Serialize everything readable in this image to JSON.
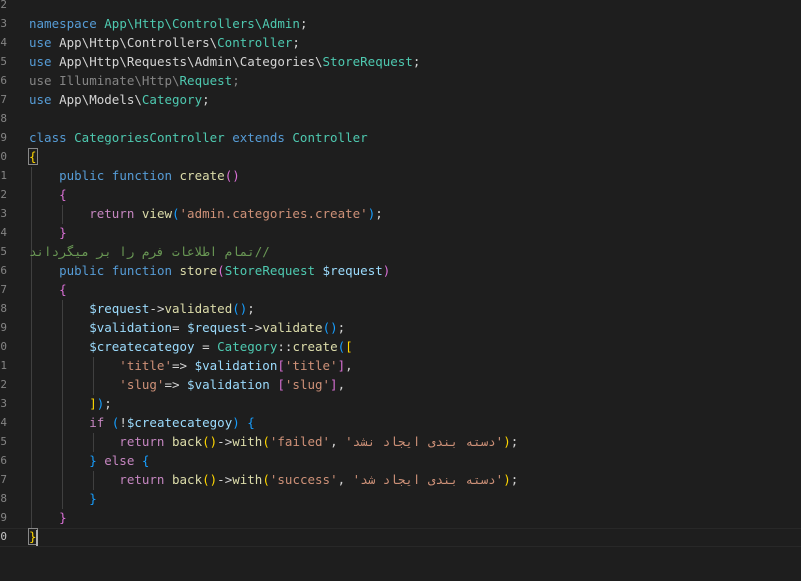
{
  "editor": {
    "line_numbers": [
      "2",
      "3",
      "4",
      "5",
      "6",
      "7",
      "8",
      "9",
      "0",
      "1",
      "2",
      "3",
      "4",
      "5",
      "6",
      "7",
      "8",
      "9",
      "0",
      "1",
      "2",
      "3",
      "4",
      "5",
      "6",
      "7",
      "8",
      "9",
      "0"
    ],
    "active_line_index": 28,
    "lines": [
      [],
      [
        {
          "t": "namespace ",
          "c": "kw"
        },
        {
          "t": "App\\Http\\Controllers\\Admin",
          "c": "cls"
        },
        {
          "t": ";",
          "c": "pln"
        }
      ],
      [
        {
          "t": "use ",
          "c": "kw"
        },
        {
          "t": "App\\Http\\Controllers\\",
          "c": "pln"
        },
        {
          "t": "Controller",
          "c": "cls"
        },
        {
          "t": ";",
          "c": "pln"
        }
      ],
      [
        {
          "t": "use ",
          "c": "kw"
        },
        {
          "t": "App\\Http\\Requests\\Admin\\Categories\\",
          "c": "pln"
        },
        {
          "t": "StoreRequest",
          "c": "cls"
        },
        {
          "t": ";",
          "c": "pln"
        }
      ],
      [
        {
          "t": "use Illuminate\\Http\\",
          "c": "dim"
        },
        {
          "t": "Request",
          "c": "cls"
        },
        {
          "t": ";",
          "c": "dim"
        }
      ],
      [
        {
          "t": "use ",
          "c": "kw"
        },
        {
          "t": "App\\Models\\",
          "c": "pln"
        },
        {
          "t": "Category",
          "c": "cls"
        },
        {
          "t": ";",
          "c": "pln"
        }
      ],
      [],
      [
        {
          "t": "class ",
          "c": "kw"
        },
        {
          "t": "CategoriesController",
          "c": "cls"
        },
        {
          "t": " extends ",
          "c": "kw"
        },
        {
          "t": "Controller",
          "c": "cls"
        }
      ],
      [
        {
          "t": "{",
          "c": "b1"
        }
      ],
      [
        {
          "t": "    public ",
          "c": "kw"
        },
        {
          "t": "function ",
          "c": "kw"
        },
        {
          "t": "create",
          "c": "fn"
        },
        {
          "t": "()",
          "c": "b2"
        }
      ],
      [
        {
          "t": "    {",
          "c": "b2"
        }
      ],
      [
        {
          "t": "        return ",
          "c": "ctl"
        },
        {
          "t": "view",
          "c": "fn"
        },
        {
          "t": "(",
          "c": "b3"
        },
        {
          "t": "'admin.categories.create'",
          "c": "str"
        },
        {
          "t": ")",
          "c": "b3"
        },
        {
          "t": ";",
          "c": "pln"
        }
      ],
      [
        {
          "t": "    }",
          "c": "b2"
        }
      ],
      [
        {
          "t": "    //تمام اطلاعات فرم را بر میگرداند",
          "c": "cmt"
        }
      ],
      [
        {
          "t": "    public ",
          "c": "kw"
        },
        {
          "t": "function ",
          "c": "kw"
        },
        {
          "t": "store",
          "c": "fn"
        },
        {
          "t": "(",
          "c": "b2"
        },
        {
          "t": "StoreRequest ",
          "c": "cls"
        },
        {
          "t": "$request",
          "c": "var"
        },
        {
          "t": ")",
          "c": "b2"
        }
      ],
      [
        {
          "t": "    {",
          "c": "b2"
        }
      ],
      [
        {
          "t": "        $request",
          "c": "var"
        },
        {
          "t": "->",
          "c": "pln"
        },
        {
          "t": "validated",
          "c": "fn"
        },
        {
          "t": "()",
          "c": "b3"
        },
        {
          "t": ";",
          "c": "pln"
        }
      ],
      [
        {
          "t": "        $validation",
          "c": "var"
        },
        {
          "t": "= ",
          "c": "pln"
        },
        {
          "t": "$request",
          "c": "var"
        },
        {
          "t": "->",
          "c": "pln"
        },
        {
          "t": "validate",
          "c": "fn"
        },
        {
          "t": "()",
          "c": "b3"
        },
        {
          "t": ";",
          "c": "pln"
        }
      ],
      [
        {
          "t": "        $createcategoy",
          "c": "var"
        },
        {
          "t": " = ",
          "c": "pln"
        },
        {
          "t": "Category",
          "c": "cls"
        },
        {
          "t": "::",
          "c": "pln"
        },
        {
          "t": "create",
          "c": "fn"
        },
        {
          "t": "(",
          "c": "b3"
        },
        {
          "t": "[",
          "c": "b1"
        }
      ],
      [
        {
          "t": "            'title'",
          "c": "str"
        },
        {
          "t": "=> ",
          "c": "pln"
        },
        {
          "t": "$validation",
          "c": "var"
        },
        {
          "t": "[",
          "c": "b2"
        },
        {
          "t": "'title'",
          "c": "str"
        },
        {
          "t": "]",
          "c": "b2"
        },
        {
          "t": ",",
          "c": "pln"
        }
      ],
      [
        {
          "t": "            'slug'",
          "c": "str"
        },
        {
          "t": "=> ",
          "c": "pln"
        },
        {
          "t": "$validation ",
          "c": "var"
        },
        {
          "t": "[",
          "c": "b2"
        },
        {
          "t": "'slug'",
          "c": "str"
        },
        {
          "t": "]",
          "c": "b2"
        },
        {
          "t": ",",
          "c": "pln"
        }
      ],
      [
        {
          "t": "        ]",
          "c": "b1"
        },
        {
          "t": ")",
          "c": "b3"
        },
        {
          "t": ";",
          "c": "pln"
        }
      ],
      [
        {
          "t": "        if ",
          "c": "ctl"
        },
        {
          "t": "(",
          "c": "b3"
        },
        {
          "t": "!",
          "c": "pln"
        },
        {
          "t": "$createcategoy",
          "c": "var"
        },
        {
          "t": ")",
          "c": "b3"
        },
        {
          "t": " ",
          "c": "pln"
        },
        {
          "t": "{",
          "c": "b3"
        }
      ],
      [
        {
          "t": "            return ",
          "c": "ctl"
        },
        {
          "t": "back",
          "c": "fn"
        },
        {
          "t": "()",
          "c": "b1"
        },
        {
          "t": "->",
          "c": "pln"
        },
        {
          "t": "with",
          "c": "fn"
        },
        {
          "t": "(",
          "c": "b1"
        },
        {
          "t": "'failed'",
          "c": "str"
        },
        {
          "t": ", ",
          "c": "pln"
        },
        {
          "t": "'دسته بندی ایجاد نشد'",
          "c": "str"
        },
        {
          "t": ")",
          "c": "b1"
        },
        {
          "t": ";",
          "c": "pln"
        }
      ],
      [
        {
          "t": "        }",
          "c": "b3"
        },
        {
          "t": " else ",
          "c": "ctl"
        },
        {
          "t": "{",
          "c": "b3"
        }
      ],
      [
        {
          "t": "            return ",
          "c": "ctl"
        },
        {
          "t": "back",
          "c": "fn"
        },
        {
          "t": "()",
          "c": "b1"
        },
        {
          "t": "->",
          "c": "pln"
        },
        {
          "t": "with",
          "c": "fn"
        },
        {
          "t": "(",
          "c": "b1"
        },
        {
          "t": "'success'",
          "c": "str"
        },
        {
          "t": ", ",
          "c": "pln"
        },
        {
          "t": "'دسته بندی ایجاد شد'",
          "c": "str"
        },
        {
          "t": ")",
          "c": "b1"
        },
        {
          "t": ";",
          "c": "pln"
        }
      ],
      [
        {
          "t": "        }",
          "c": "b3"
        }
      ],
      [
        {
          "t": "    }",
          "c": "b2"
        }
      ],
      [
        {
          "t": "}",
          "c": "b1"
        }
      ]
    ]
  }
}
